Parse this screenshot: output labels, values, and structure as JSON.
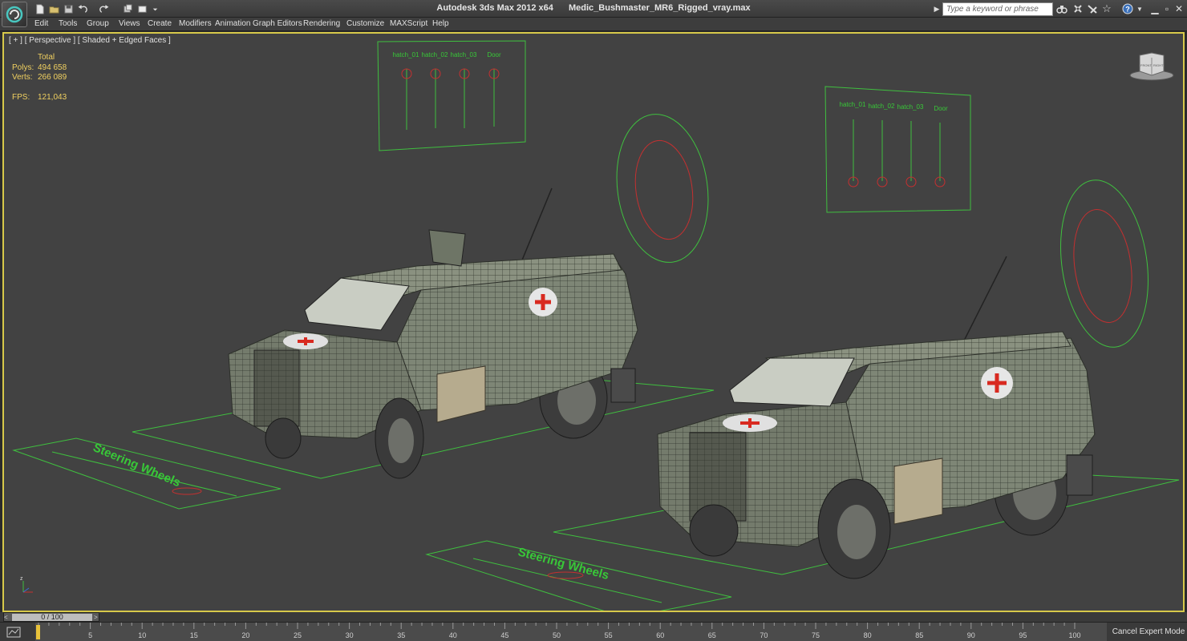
{
  "app": {
    "title": "Autodesk 3ds Max  2012 x64",
    "file": "Medic_Bushmaster_MR6_Rigged_vray.max"
  },
  "search": {
    "placeholder": "Type a keyword or phrase"
  },
  "menu": [
    "Edit",
    "Tools",
    "Group",
    "Views",
    "Create",
    "Modifiers",
    "Animation",
    "Graph Editors",
    "Rendering",
    "Customize",
    "MAXScript",
    "Help"
  ],
  "viewport": {
    "label": "[ + ] [ Perspective ] [ Shaded + Edged Faces ]",
    "stats": {
      "total_label": "Total",
      "polys_label": "Polys:",
      "polys_value": "494 658",
      "verts_label": "Verts:",
      "verts_value": "266 089",
      "fps_label": "FPS:",
      "fps_value": "121,043"
    },
    "rig_panels": [
      {
        "labels": [
          "hatch_01",
          "hatch_02",
          "hatch_03",
          "Door"
        ]
      },
      {
        "labels": [
          "hatch_01",
          "hatch_02",
          "hatch_03",
          "Door"
        ]
      }
    ],
    "floor_text": "Steering Wheels",
    "viewcube": {
      "front": "FRONT",
      "right": "RIGHT"
    }
  },
  "timeline": {
    "frame_label": "0 / 100",
    "prev": "<",
    "next": ">",
    "ticks": [
      0,
      5,
      10,
      15,
      20,
      25,
      30,
      35,
      40,
      45,
      50,
      55,
      60,
      65,
      70,
      75,
      80,
      85,
      90,
      95,
      100
    ]
  },
  "status": {
    "cancel_expert": "Cancel Expert Mode"
  },
  "colors": {
    "viewport_bg": "#424242",
    "active_border": "#d7c94a",
    "stats_text": "#f0d060",
    "rig_green": "#3fbf3f",
    "rig_red": "#c43030",
    "vehicle_body": "#8a9180",
    "wire": "#2f332c",
    "medic_cross": "#d82a20"
  },
  "icons": {
    "app_logo": "3ds-max-logo-icon",
    "viewcube": "viewcube-icon",
    "axis": "axis-tripod-icon"
  }
}
